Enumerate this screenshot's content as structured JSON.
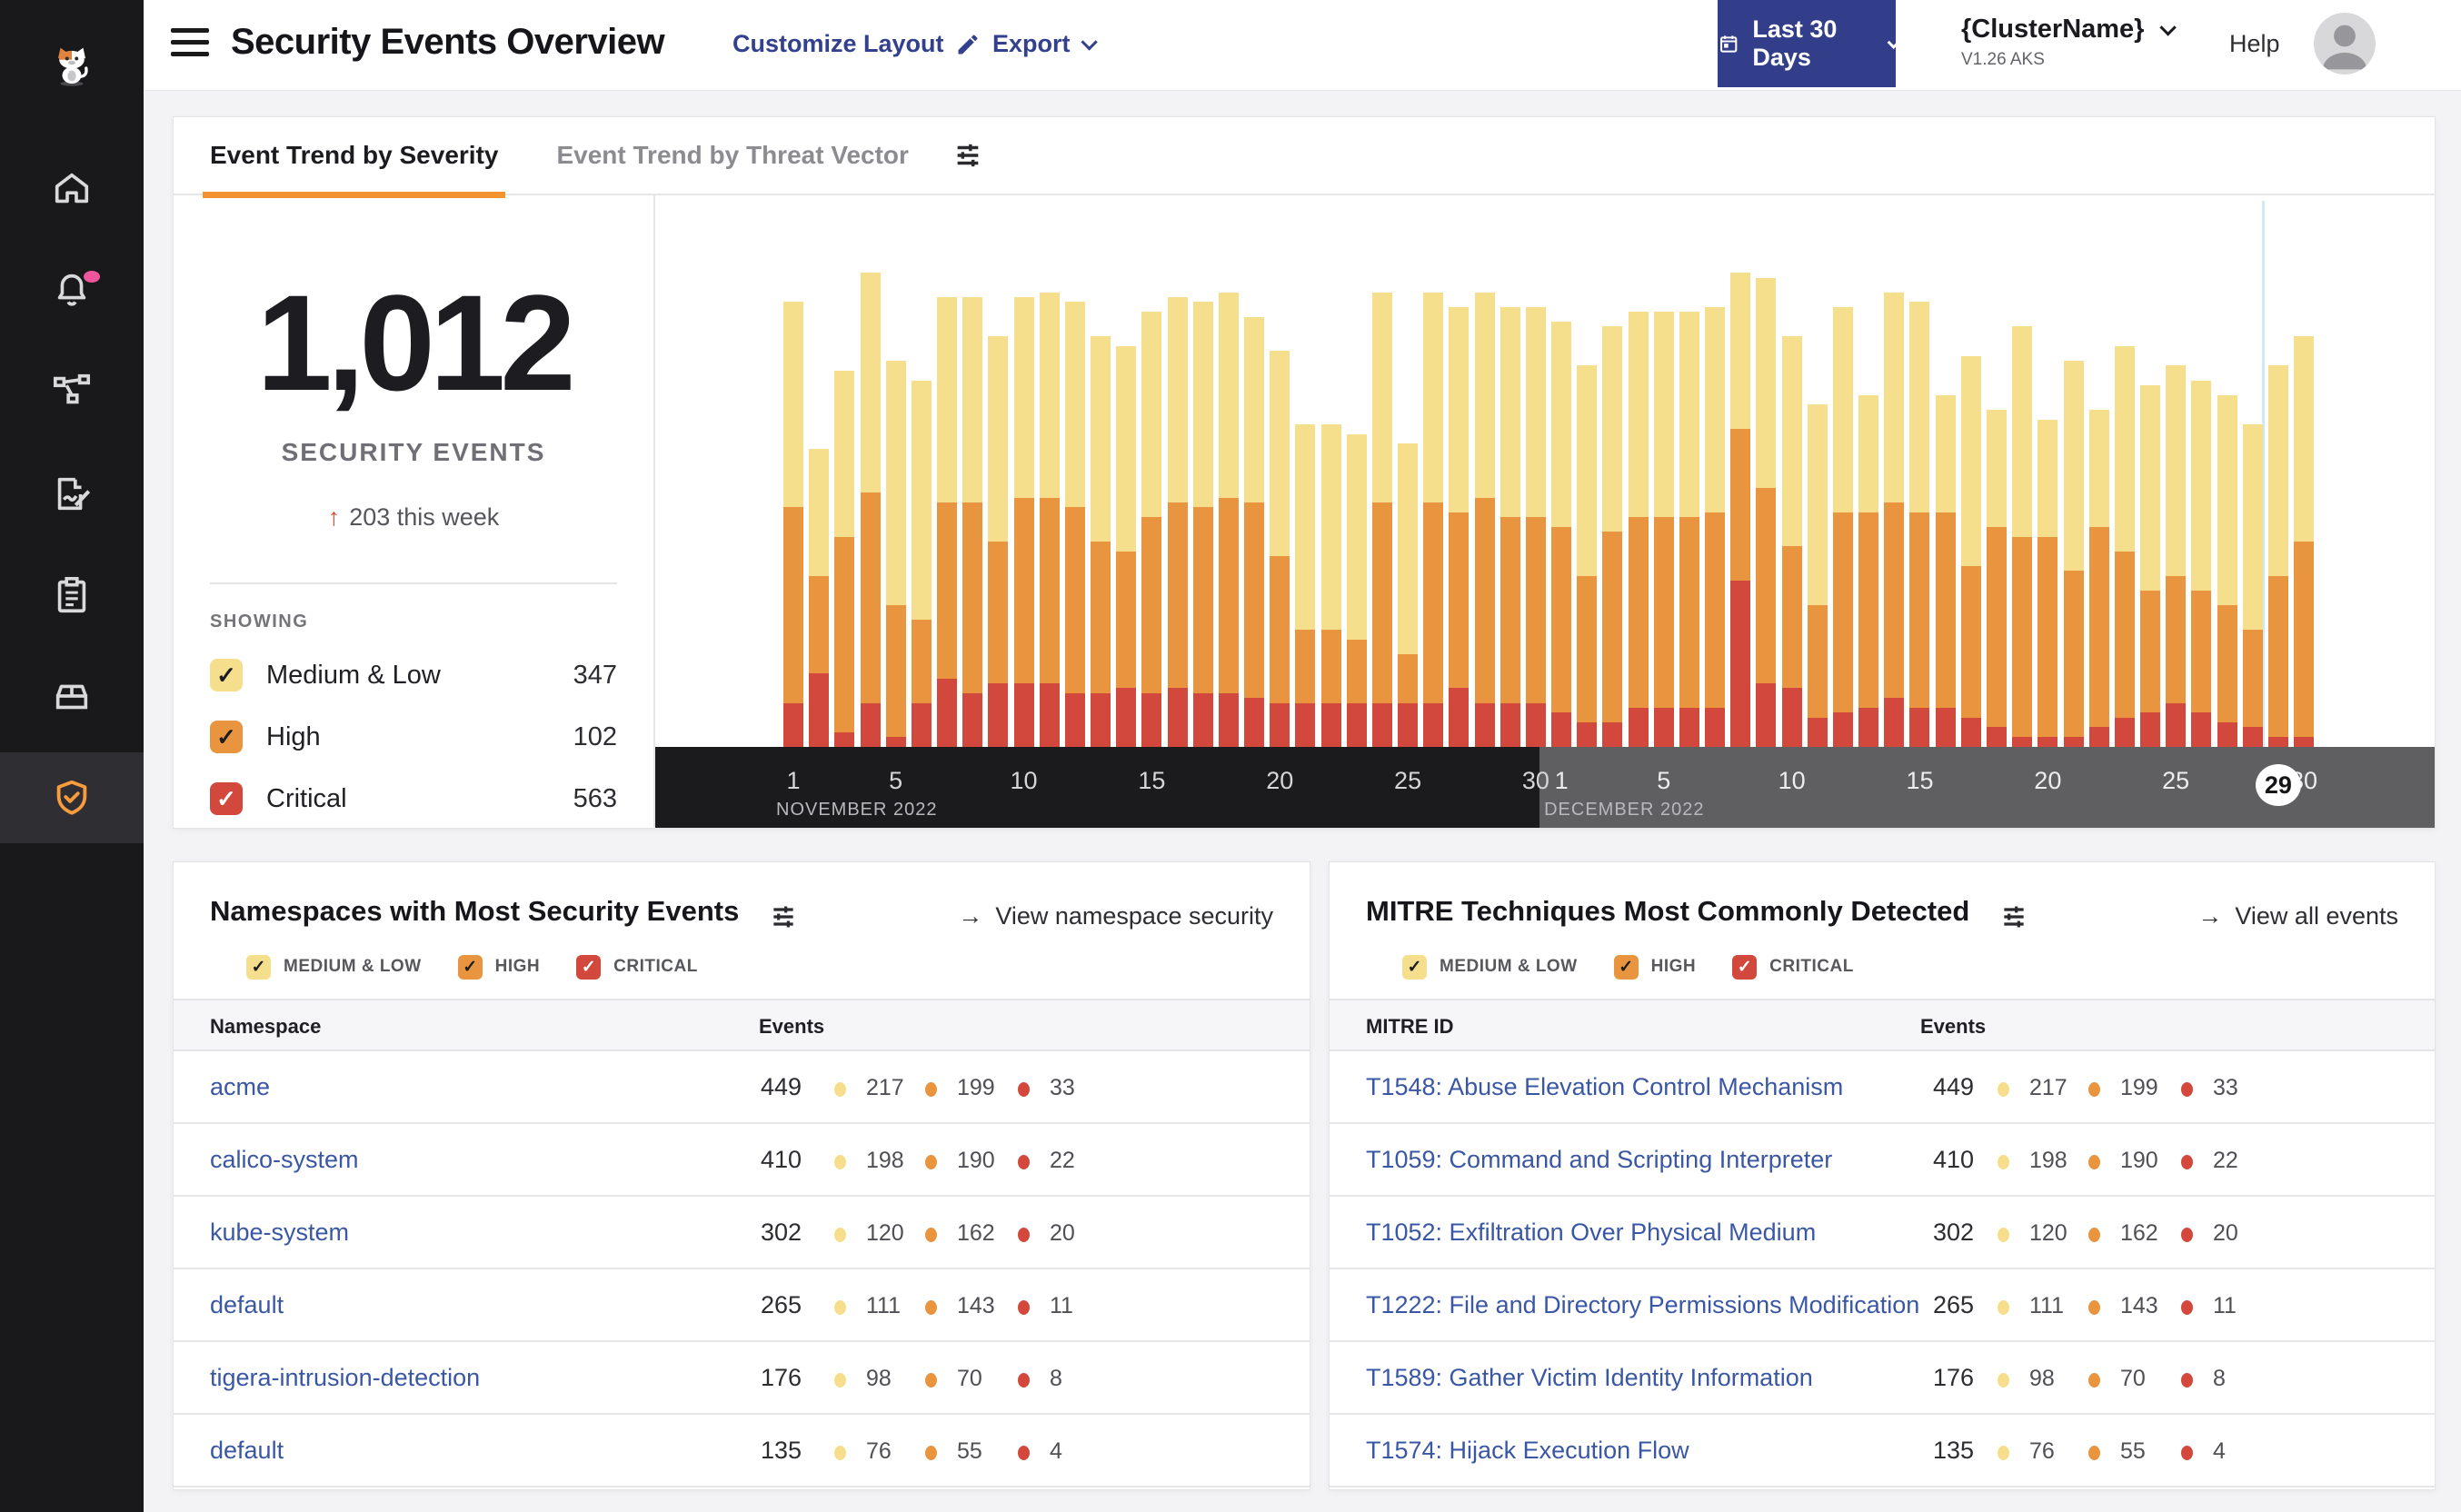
{
  "header": {
    "title": "Security Events Overview",
    "customize_label": "Customize Layout",
    "export_label": "Export",
    "date_range_label": "Last 30 Days",
    "cluster_name": "{ClusterName}",
    "cluster_version": "V1.26 AKS",
    "help_label": "Help",
    "button_color": "#323e8a"
  },
  "sidebar": {
    "items": [
      {
        "icon": "calico-cat-logo"
      },
      {
        "icon": "home-icon"
      },
      {
        "icon": "alerts-bell-icon",
        "badge": "pink-dot"
      },
      {
        "icon": "service-graph-icon"
      },
      {
        "icon": "policies-edit-icon"
      },
      {
        "icon": "compliance-clipboard-icon"
      },
      {
        "icon": "workloads-box-icon"
      },
      {
        "icon": "threat-defense-shield-icon",
        "active": true
      }
    ],
    "active_color": "#f89c3e"
  },
  "trend_panel": {
    "tabs": [
      {
        "label": "Event Trend by Severity",
        "active": true
      },
      {
        "label": "Event Trend by Threat Vector",
        "active": false
      }
    ],
    "stat": {
      "value": "1,012",
      "label": "SECURITY EVENTS",
      "delta_arrow": "↑",
      "delta_text": "203 this week"
    },
    "showing_label": "SHOWING",
    "showing": [
      {
        "label": "Medium & Low",
        "count": "347",
        "color": "#F5DF8C",
        "check": "#1d1d21"
      },
      {
        "label": "High",
        "count": "102",
        "color": "#E9953F",
        "check": "#1d1d21"
      },
      {
        "label": "Critical",
        "count": "563",
        "color": "#D3483D",
        "check": "#ffffff"
      }
    ],
    "chart_data": {
      "type": "bar",
      "stacked": true,
      "units": "percent of chart height (no y-axis shown)",
      "ylim": [
        0,
        100
      ],
      "categories": [
        "Nov 1",
        "Nov 2",
        "Nov 3",
        "Nov 4",
        "Nov 5",
        "Nov 6",
        "Nov 7",
        "Nov 8",
        "Nov 9",
        "Nov 10",
        "Nov 11",
        "Nov 12",
        "Nov 13",
        "Nov 14",
        "Nov 15",
        "Nov 16",
        "Nov 17",
        "Nov 18",
        "Nov 19",
        "Nov 20",
        "Nov 21",
        "Nov 22",
        "Nov 23",
        "Nov 24",
        "Nov 25",
        "Nov 26",
        "Nov 27",
        "Nov 28",
        "Nov 29",
        "Nov 30",
        "Dec 1",
        "Dec 2",
        "Dec 3",
        "Dec 4",
        "Dec 5",
        "Dec 6",
        "Dec 7",
        "Dec 8",
        "Dec 9",
        "Dec 10",
        "Dec 11",
        "Dec 12",
        "Dec 13",
        "Dec 14",
        "Dec 15",
        "Dec 16",
        "Dec 17",
        "Dec 18",
        "Dec 19",
        "Dec 20",
        "Dec 21",
        "Dec 22",
        "Dec 23",
        "Dec 24",
        "Dec 25",
        "Dec 26",
        "Dec 27",
        "Dec 28",
        "Dec 29",
        "Dec 30"
      ],
      "series": [
        {
          "name": "Critical",
          "color": "#D3483D",
          "values": [
            9,
            15,
            3,
            9,
            2,
            9,
            14,
            11,
            13,
            13,
            13,
            11,
            11,
            12,
            11,
            12,
            11,
            11,
            10,
            9,
            9,
            9,
            9,
            9,
            9,
            9,
            12,
            9,
            9,
            9,
            7,
            5,
            5,
            8,
            8,
            8,
            8,
            34,
            13,
            12,
            6,
            7,
            8,
            10,
            8,
            8,
            6,
            4,
            2,
            2,
            2,
            4,
            6,
            7,
            9,
            7,
            5,
            4,
            2,
            2
          ]
        },
        {
          "name": "High",
          "color": "#E9953F",
          "values": [
            40,
            20,
            40,
            43,
            27,
            17,
            36,
            39,
            29,
            38,
            38,
            38,
            31,
            28,
            36,
            38,
            38,
            40,
            40,
            30,
            15,
            15,
            13,
            41,
            10,
            41,
            36,
            42,
            38,
            38,
            38,
            30,
            39,
            39,
            39,
            39,
            40,
            31,
            40,
            29,
            23,
            41,
            40,
            40,
            40,
            40,
            31,
            41,
            41,
            41,
            34,
            41,
            34,
            25,
            26,
            25,
            24,
            20,
            33,
            40
          ]
        },
        {
          "name": "Medium & Low",
          "color": "#F5DF8C",
          "values": [
            42,
            26,
            34,
            45,
            50,
            49,
            42,
            42,
            42,
            41,
            42,
            42,
            42,
            42,
            42,
            42,
            42,
            42,
            38,
            42,
            42,
            42,
            42,
            43,
            43,
            43,
            42,
            42,
            43,
            43,
            42,
            43,
            42,
            42,
            42,
            42,
            42,
            32,
            43,
            43,
            41,
            42,
            24,
            43,
            43,
            24,
            43,
            24,
            43,
            24,
            43,
            24,
            42,
            42,
            43,
            43,
            43,
            42,
            43,
            42
          ]
        }
      ],
      "x_ticks": [
        {
          "index": 0,
          "label": "1",
          "month": "nov"
        },
        {
          "index": 4,
          "label": "5",
          "month": "nov"
        },
        {
          "index": 9,
          "label": "10",
          "month": "nov"
        },
        {
          "index": 14,
          "label": "15",
          "month": "nov"
        },
        {
          "index": 19,
          "label": "20",
          "month": "nov"
        },
        {
          "index": 24,
          "label": "25",
          "month": "nov"
        },
        {
          "index": 29,
          "label": "30",
          "month": "nov"
        },
        {
          "index": 30,
          "label": "1",
          "month": "dec"
        },
        {
          "index": 34,
          "label": "5",
          "month": "dec"
        },
        {
          "index": 39,
          "label": "10",
          "month": "dec"
        },
        {
          "index": 44,
          "label": "15",
          "month": "dec"
        },
        {
          "index": 49,
          "label": "20",
          "month": "dec"
        },
        {
          "index": 54,
          "label": "25",
          "month": "dec"
        },
        {
          "index": 59,
          "label": "30",
          "month": "dec"
        }
      ],
      "months": [
        {
          "label": "NOVEMBER 2022",
          "start_index": 0
        },
        {
          "label": "DECEMBER 2022",
          "start_index": 30
        }
      ],
      "highlighted_day": {
        "index": 58,
        "label": "29"
      },
      "legend_position": "none",
      "grid": false
    }
  },
  "severity_filters": [
    {
      "label": "MEDIUM & LOW",
      "color": "#F5DF8C",
      "check": "#1d1d21"
    },
    {
      "label": "HIGH",
      "color": "#E9953F",
      "check": "#1d1d21"
    },
    {
      "label": "CRITICAL",
      "color": "#D3483D",
      "check": "#ffffff"
    }
  ],
  "namespaces_panel": {
    "title": "Namespaces with Most Security Events",
    "view_link": {
      "arrow": "→",
      "label": "View namespace security"
    },
    "columns": {
      "name": "Namespace",
      "events": "Events"
    },
    "rows": [
      {
        "name": "acme",
        "total": "449",
        "medium_low": "217",
        "high": "199",
        "critical": "33"
      },
      {
        "name": "calico-system",
        "total": "410",
        "medium_low": "198",
        "high": "190",
        "critical": "22"
      },
      {
        "name": "kube-system",
        "total": "302",
        "medium_low": "120",
        "high": "162",
        "critical": "20"
      },
      {
        "name": "default",
        "total": "265",
        "medium_low": "111",
        "high": "143",
        "critical": "11"
      },
      {
        "name": "tigera-intrusion-detection",
        "total": "176",
        "medium_low": "98",
        "high": "70",
        "critical": "8"
      },
      {
        "name": "default",
        "total": "135",
        "medium_low": "76",
        "high": "55",
        "critical": "4"
      }
    ]
  },
  "mitre_panel": {
    "title": "MITRE Techniques Most Commonly Detected",
    "view_link": {
      "arrow": "→",
      "label": "View all events"
    },
    "columns": {
      "name": "MITRE ID",
      "events": "Events"
    },
    "rows": [
      {
        "name": "T1548: Abuse Elevation Control Mechanism",
        "total": "449",
        "medium_low": "217",
        "high": "199",
        "critical": "33"
      },
      {
        "name": "T1059: Command and Scripting Interpreter",
        "total": "410",
        "medium_low": "198",
        "high": "190",
        "critical": "22"
      },
      {
        "name": "T1052: Exfiltration Over Physical Medium",
        "total": "302",
        "medium_low": "120",
        "high": "162",
        "critical": "20"
      },
      {
        "name": "T1222: File and Directory Permissions Modification",
        "total": "265",
        "medium_low": "111",
        "high": "143",
        "critical": "11"
      },
      {
        "name": "T1589: Gather Victim Identity Information",
        "total": "176",
        "medium_low": "98",
        "high": "70",
        "critical": "8"
      },
      {
        "name": "T1574: Hijack Execution Flow",
        "total": "135",
        "medium_low": "76",
        "high": "55",
        "critical": "4"
      }
    ]
  },
  "colors": {
    "medium_low": "#F5DF8C",
    "high": "#E9953F",
    "critical": "#D3483D",
    "accent_orange": "#F2932F",
    "link_blue": "#3A57A6",
    "navy": "#32408E",
    "nov_band": "#1b1b1d",
    "dec_band": "#5f5f62",
    "highlight_line": "#cfe8f6"
  }
}
